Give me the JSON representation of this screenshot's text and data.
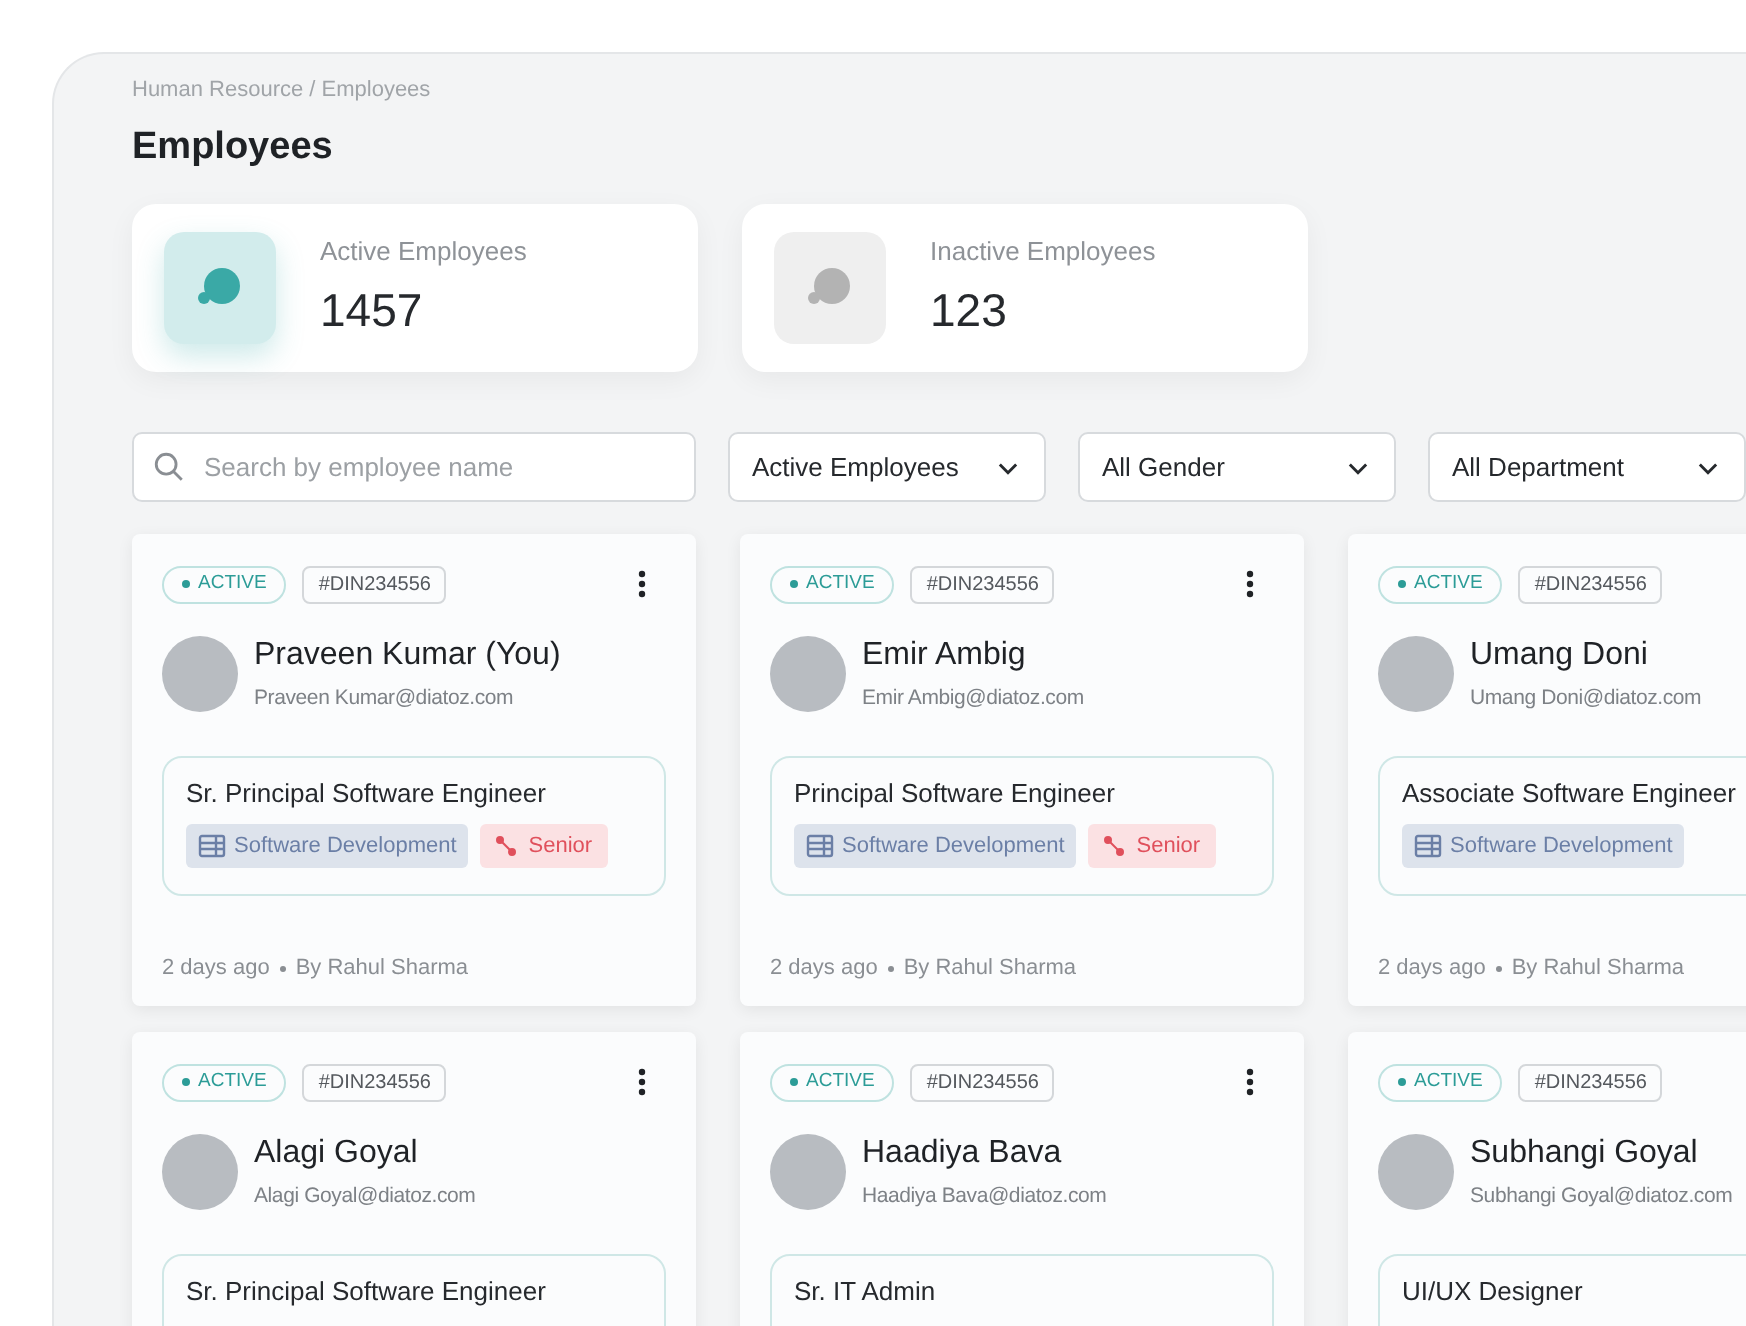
{
  "breadcrumb": "Human Resource / Employees",
  "title": "Employees",
  "stats": [
    {
      "label": "Active Employees",
      "value": "1457",
      "selected": true
    },
    {
      "label": "Inactive Employees",
      "value": "123",
      "selected": false
    }
  ],
  "search": {
    "placeholder": "Search by employee name"
  },
  "filters": [
    "Active Employees",
    "All Gender",
    "All Department"
  ],
  "employees": [
    {
      "status": "ACTIVE",
      "id": "#DIN234556",
      "name": "Praveen Kumar (You)",
      "email": "Praveen Kumar@diatoz.com",
      "role": "Sr. Principal Software Engineer",
      "department": "Software Development",
      "level": "Senior",
      "meta": "2 days ago",
      "author": "By Rahul Sharma"
    },
    {
      "status": "ACTIVE",
      "id": "#DIN234556",
      "name": "Emir Ambig",
      "email": "Emir Ambig@diatoz.com",
      "role": "Principal Software Engineer",
      "department": "Software Development",
      "level": "Senior",
      "meta": "2 days ago",
      "author": "By Rahul Sharma"
    },
    {
      "status": "ACTIVE",
      "id": "#DIN234556",
      "name": "Umang Doni",
      "email": "Umang Doni@diatoz.com",
      "role": "Associate Software Engineer",
      "department": "Software Development",
      "meta": "2 days ago",
      "author": "By Rahul Sharma"
    },
    {
      "status": "ACTIVE",
      "id": "#DIN234556",
      "name": "Alagi Goyal",
      "email": "Alagi Goyal@diatoz.com",
      "role": "Sr. Principal Software Engineer"
    },
    {
      "status": "ACTIVE",
      "id": "#DIN234556",
      "name": "Haadiya Bava",
      "email": "Haadiya Bava@diatoz.com",
      "role": "Sr. IT Admin"
    },
    {
      "status": "ACTIVE",
      "id": "#DIN234556",
      "name": "Subhangi Goyal",
      "email": "Subhangi Goyal@diatoz.com",
      "role": "UI/UX Designer"
    }
  ]
}
